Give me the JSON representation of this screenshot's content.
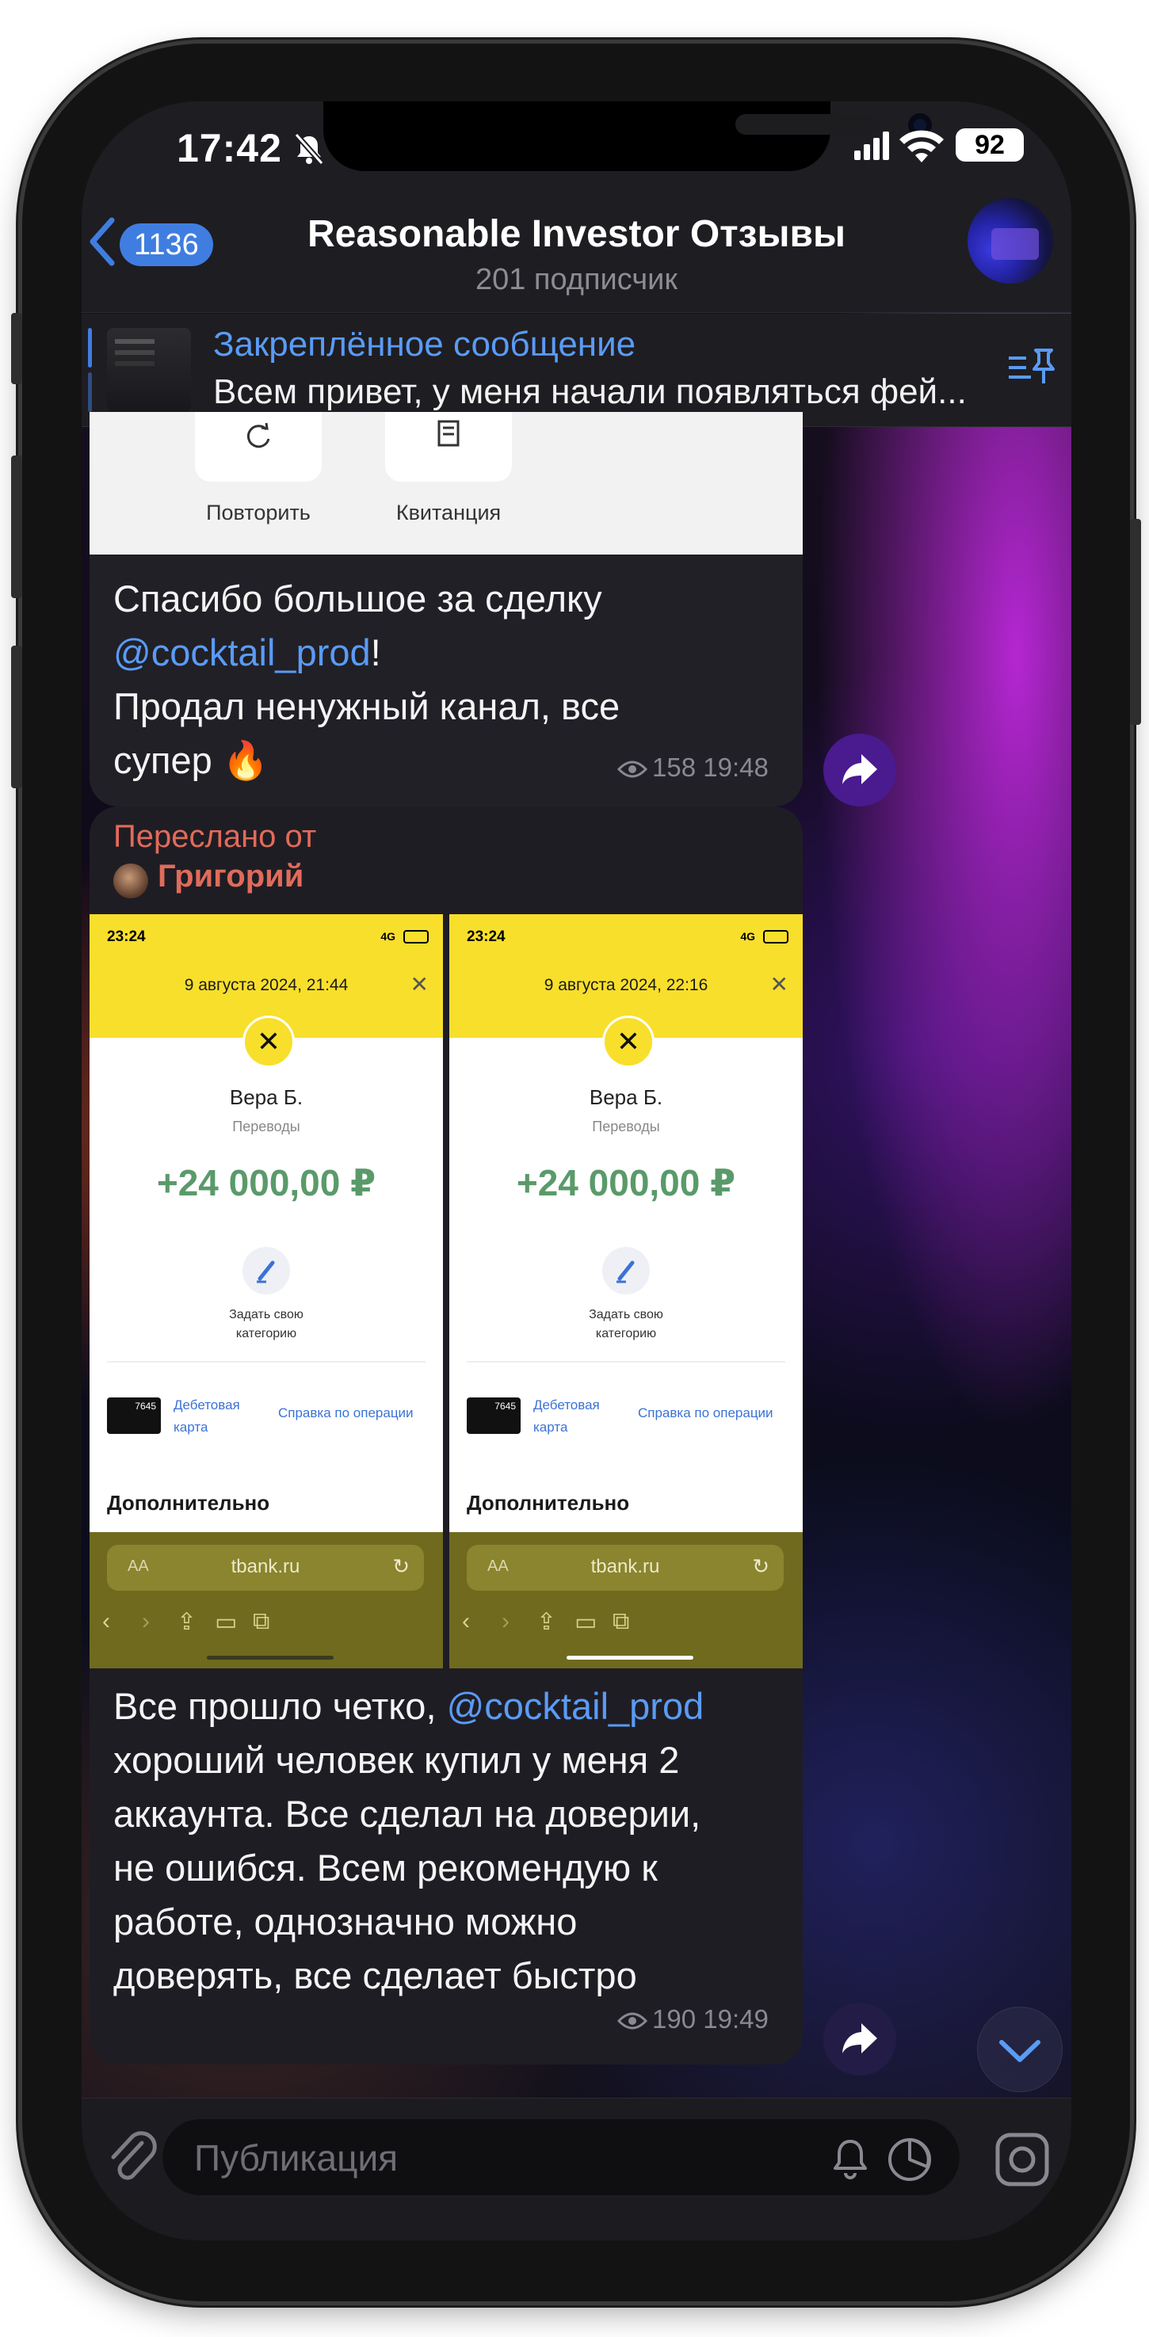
{
  "status_bar": {
    "time": "17:42",
    "battery": "92"
  },
  "header": {
    "back_count": "1136",
    "title": "Reasonable Investor Отзывы",
    "subtitle": "201 подписчик"
  },
  "pinned": {
    "title": "Закреплённое сообщение",
    "text": "Всем привет, у меня начали появляться фей..."
  },
  "messages": [
    {
      "image_actions": [
        "Повторить",
        "Квитанция"
      ],
      "text_before": "Спасибо большое за сделку",
      "mention": "@cocktail_prod",
      "text_after_mention": "!",
      "text_line3": "Продал ненужный канал, все",
      "text_line4": "супер 🔥",
      "views": "158",
      "time": "19:48"
    },
    {
      "forwarded_label": "Переслано от",
      "forwarded_name": "Григорий",
      "screenshots": [
        {
          "time": "23:24",
          "network": "4G",
          "date": "9 августа 2024, 21:44",
          "name": "Вера Б.",
          "category": "Переводы",
          "amount": "+24 000,00 ₽",
          "set_category": "Задать свою категорию",
          "card_number": "7645",
          "card_type": "Дебетовая карта",
          "help_link": "Справка по операции",
          "extra": "Дополнительно",
          "aa": "AA",
          "url": "tbank.ru"
        },
        {
          "time": "23:24",
          "network": "4G",
          "date": "9 августа 2024, 22:16",
          "name": "Вера Б.",
          "category": "Переводы",
          "amount": "+24 000,00 ₽",
          "set_category": "Задать свою категорию",
          "card_number": "7645",
          "card_type": "Дебетовая карта",
          "help_link": "Справка по операции",
          "extra": "Дополнительно",
          "aa": "AA",
          "url": "tbank.ru"
        }
      ],
      "text_start": "Все прошло четко,",
      "mention": "@cocktail_prod",
      "text_lines": [
        "хороший человек купил у меня 2",
        "аккаунта. Все сделал на доверии,",
        "не ошибся. Всем рекомендую к",
        "работе, однозначно можно",
        "доверять, все сделает быстро"
      ],
      "views": "190",
      "time": "19:49"
    }
  ],
  "input": {
    "placeholder": "Публикация"
  },
  "colors": {
    "accent": "#3f7ee0",
    "link": "#5a9bf5",
    "forward": "#e16b5a",
    "bank_yellow": "#f8df2c",
    "amount_green": "#5a9a6a"
  },
  "icons": [
    "back-chevron-icon",
    "bell-off-icon",
    "signal-icon",
    "wifi-icon",
    "pin-list-icon",
    "refresh-icon",
    "receipt-icon",
    "eye-icon",
    "share-icon",
    "attach-icon",
    "bell-icon",
    "timer-icon",
    "sticker-icon",
    "chevron-down-icon"
  ]
}
